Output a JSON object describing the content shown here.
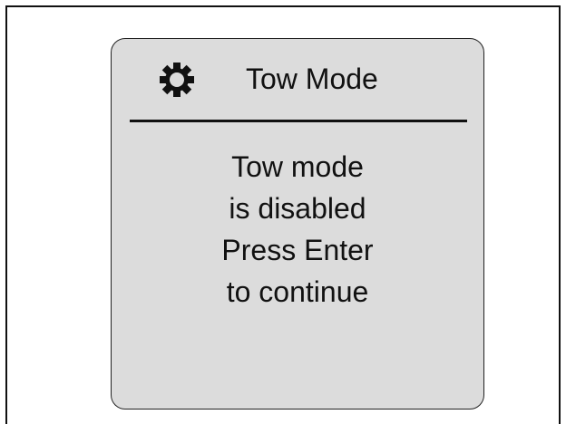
{
  "dialog": {
    "title": "Tow Mode",
    "icon": "gear-icon",
    "message_lines": [
      "Tow mode",
      "is disabled",
      "Press Enter",
      "to continue"
    ]
  },
  "colors": {
    "screen_background": "#dcdcdc",
    "text": "#111111",
    "page_background": "#ffffff"
  }
}
